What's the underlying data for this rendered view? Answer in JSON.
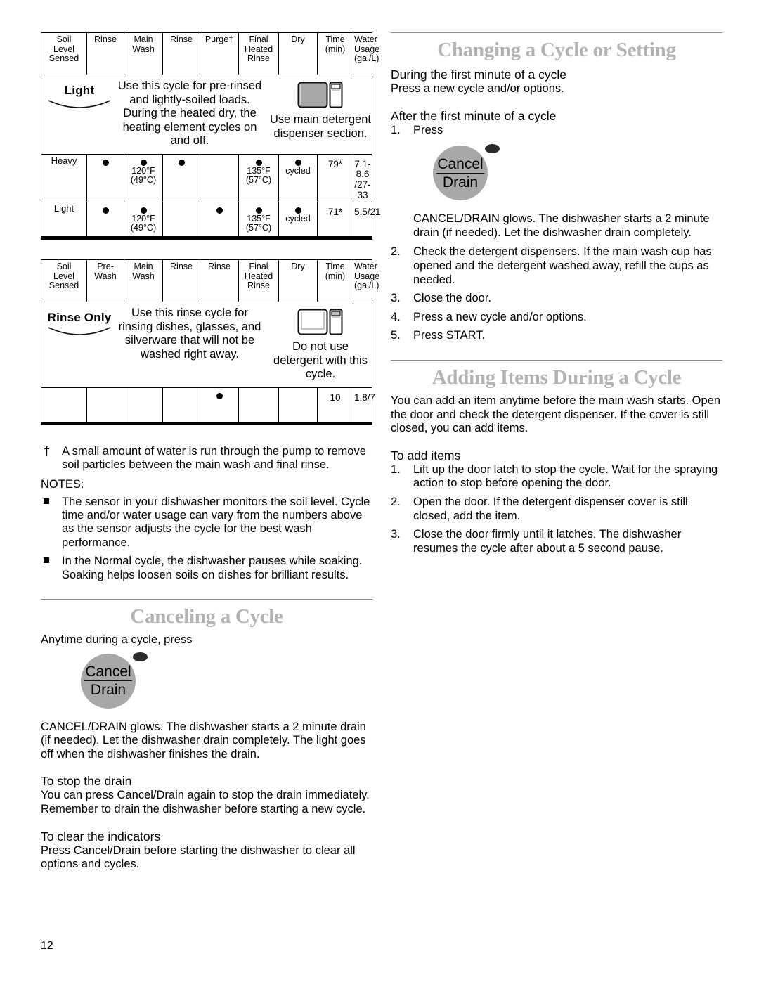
{
  "page": {
    "number": "12"
  },
  "cycles": [
    {
      "name": "Light",
      "description": "Use this cycle for pre-rinsed and lightly-soiled loads. During the heated dry, the heating element cycles on and off.",
      "dispenser_icon": "detergent-dispenser-filled-icon",
      "dispenser_note": "Use main detergent dispenser section.",
      "headers": [
        "Soil Level Sensed",
        "Rinse",
        "Main Wash",
        "Rinse",
        "Purge†",
        "Final Heated Rinse",
        "Dry",
        "Time (min)",
        "Water Usage (gal/L)"
      ],
      "rows": [
        {
          "label": "Heavy",
          "cells": [
            {
              "dot": true,
              "text": ""
            },
            {
              "dot": true,
              "text": "120°F\n(49°C)"
            },
            {
              "dot": true,
              "text": ""
            },
            {
              "dot": false,
              "text": ""
            },
            {
              "dot": true,
              "text": "135°F\n(57°C)"
            },
            {
              "dot": true,
              "text": "cycled"
            },
            {
              "dot": false,
              "text": "79*"
            },
            {
              "dot": false,
              "text": "7.1-8.6\n/27-33"
            }
          ]
        },
        {
          "label": "Light",
          "cells": [
            {
              "dot": true,
              "text": ""
            },
            {
              "dot": true,
              "text": "120°F\n(49°C)"
            },
            {
              "dot": false,
              "text": ""
            },
            {
              "dot": true,
              "text": ""
            },
            {
              "dot": true,
              "text": "135°F\n(57°C)"
            },
            {
              "dot": true,
              "text": "cycled"
            },
            {
              "dot": false,
              "text": "71*"
            },
            {
              "dot": false,
              "text": "5.5/21"
            }
          ]
        }
      ]
    },
    {
      "name": "Rinse Only",
      "description": "Use this rinse cycle for rinsing dishes, glasses, and silverware that will not be washed right away.",
      "dispenser_icon": "detergent-dispenser-empty-icon",
      "dispenser_note": "Do not use detergent with this cycle.",
      "headers": [
        "Soil Level Sensed",
        "Pre-Wash",
        "Main Wash",
        "Rinse",
        "Rinse",
        "Final Heated Rinse",
        "Dry",
        "Time (min)",
        "Water Usage (gal/L)"
      ],
      "rows": [
        {
          "label": "",
          "cells": [
            {
              "dot": false,
              "text": ""
            },
            {
              "dot": false,
              "text": ""
            },
            {
              "dot": false,
              "text": ""
            },
            {
              "dot": true,
              "text": ""
            },
            {
              "dot": false,
              "text": ""
            },
            {
              "dot": false,
              "text": ""
            },
            {
              "dot": false,
              "text": "10"
            },
            {
              "dot": false,
              "text": "1.8/7"
            }
          ]
        }
      ]
    }
  ],
  "footnote": {
    "marker": "†",
    "text": "A small amount of water is run through the pump to remove soil particles between the main wash and final rinse."
  },
  "notes": {
    "title": "NOTES:",
    "items": [
      "The sensor in your dishwasher monitors the soil level. Cycle time and/or water usage can vary from the numbers above as the sensor adjusts the cycle for the best wash performance.",
      "In the Normal cycle, the dishwasher pauses while soaking. Soaking helps loosen soils on dishes for brilliant results."
    ]
  },
  "canceling": {
    "heading": "Canceling a Cycle",
    "intro": "Anytime during a cycle, press",
    "button": {
      "top_label": "Cancel",
      "bottom_label": "Drain",
      "indicator": "indicator-light"
    },
    "after_button": "CANCEL/DRAIN glows. The dishwasher starts a 2 minute drain (if needed). Let the dishwasher drain completely. The light goes off when the dishwasher finishes the drain.",
    "stop_drain": {
      "heading": "To stop the drain",
      "text": "You can press Cancel/Drain again to stop the drain immediately. Remember to drain the dishwasher before starting a new cycle."
    },
    "clear_indicators": {
      "heading": "To clear the indicators",
      "text": "Press Cancel/Drain before starting the dishwasher to clear all options and cycles."
    }
  },
  "changing": {
    "heading": "Changing a Cycle or Setting",
    "during_first_minute": {
      "heading": "During the first minute of a cycle",
      "text": "Press a new cycle and/or options."
    },
    "after_first_minute": {
      "heading": "After the first minute of a cycle",
      "step1_number": "1.",
      "step1_text": "Press",
      "button": {
        "top_label": "Cancel",
        "bottom_label": "Drain",
        "indicator": "indicator-light"
      },
      "step1_detail": "CANCEL/DRAIN glows. The dishwasher starts a 2 minute drain (if needed). Let the dishwasher drain completely.",
      "steps": [
        {
          "number": "2.",
          "text": "Check the detergent dispensers. If the main wash cup has opened and the detergent washed away, refill the cups as needed."
        },
        {
          "number": "3.",
          "text": "Close the door."
        },
        {
          "number": "4.",
          "text": "Press a new cycle and/or options."
        },
        {
          "number": "5.",
          "text": "Press START."
        }
      ]
    }
  },
  "adding": {
    "heading": "Adding Items During a Cycle",
    "intro": "You can add an item anytime before the main wash starts. Open the door and check the detergent dispenser. If the cover is still closed, you can add items.",
    "to_add": {
      "heading": "To add items",
      "steps": [
        {
          "number": "1.",
          "text": "Lift up the door latch to stop the cycle. Wait for the spraying action to stop before opening the door."
        },
        {
          "number": "2.",
          "text": "Open the door. If the detergent dispenser cover is still closed, add the item."
        },
        {
          "number": "3.",
          "text": "Close the door firmly until it latches. The dishwasher resumes the cycle after about a 5 second pause."
        }
      ]
    }
  }
}
